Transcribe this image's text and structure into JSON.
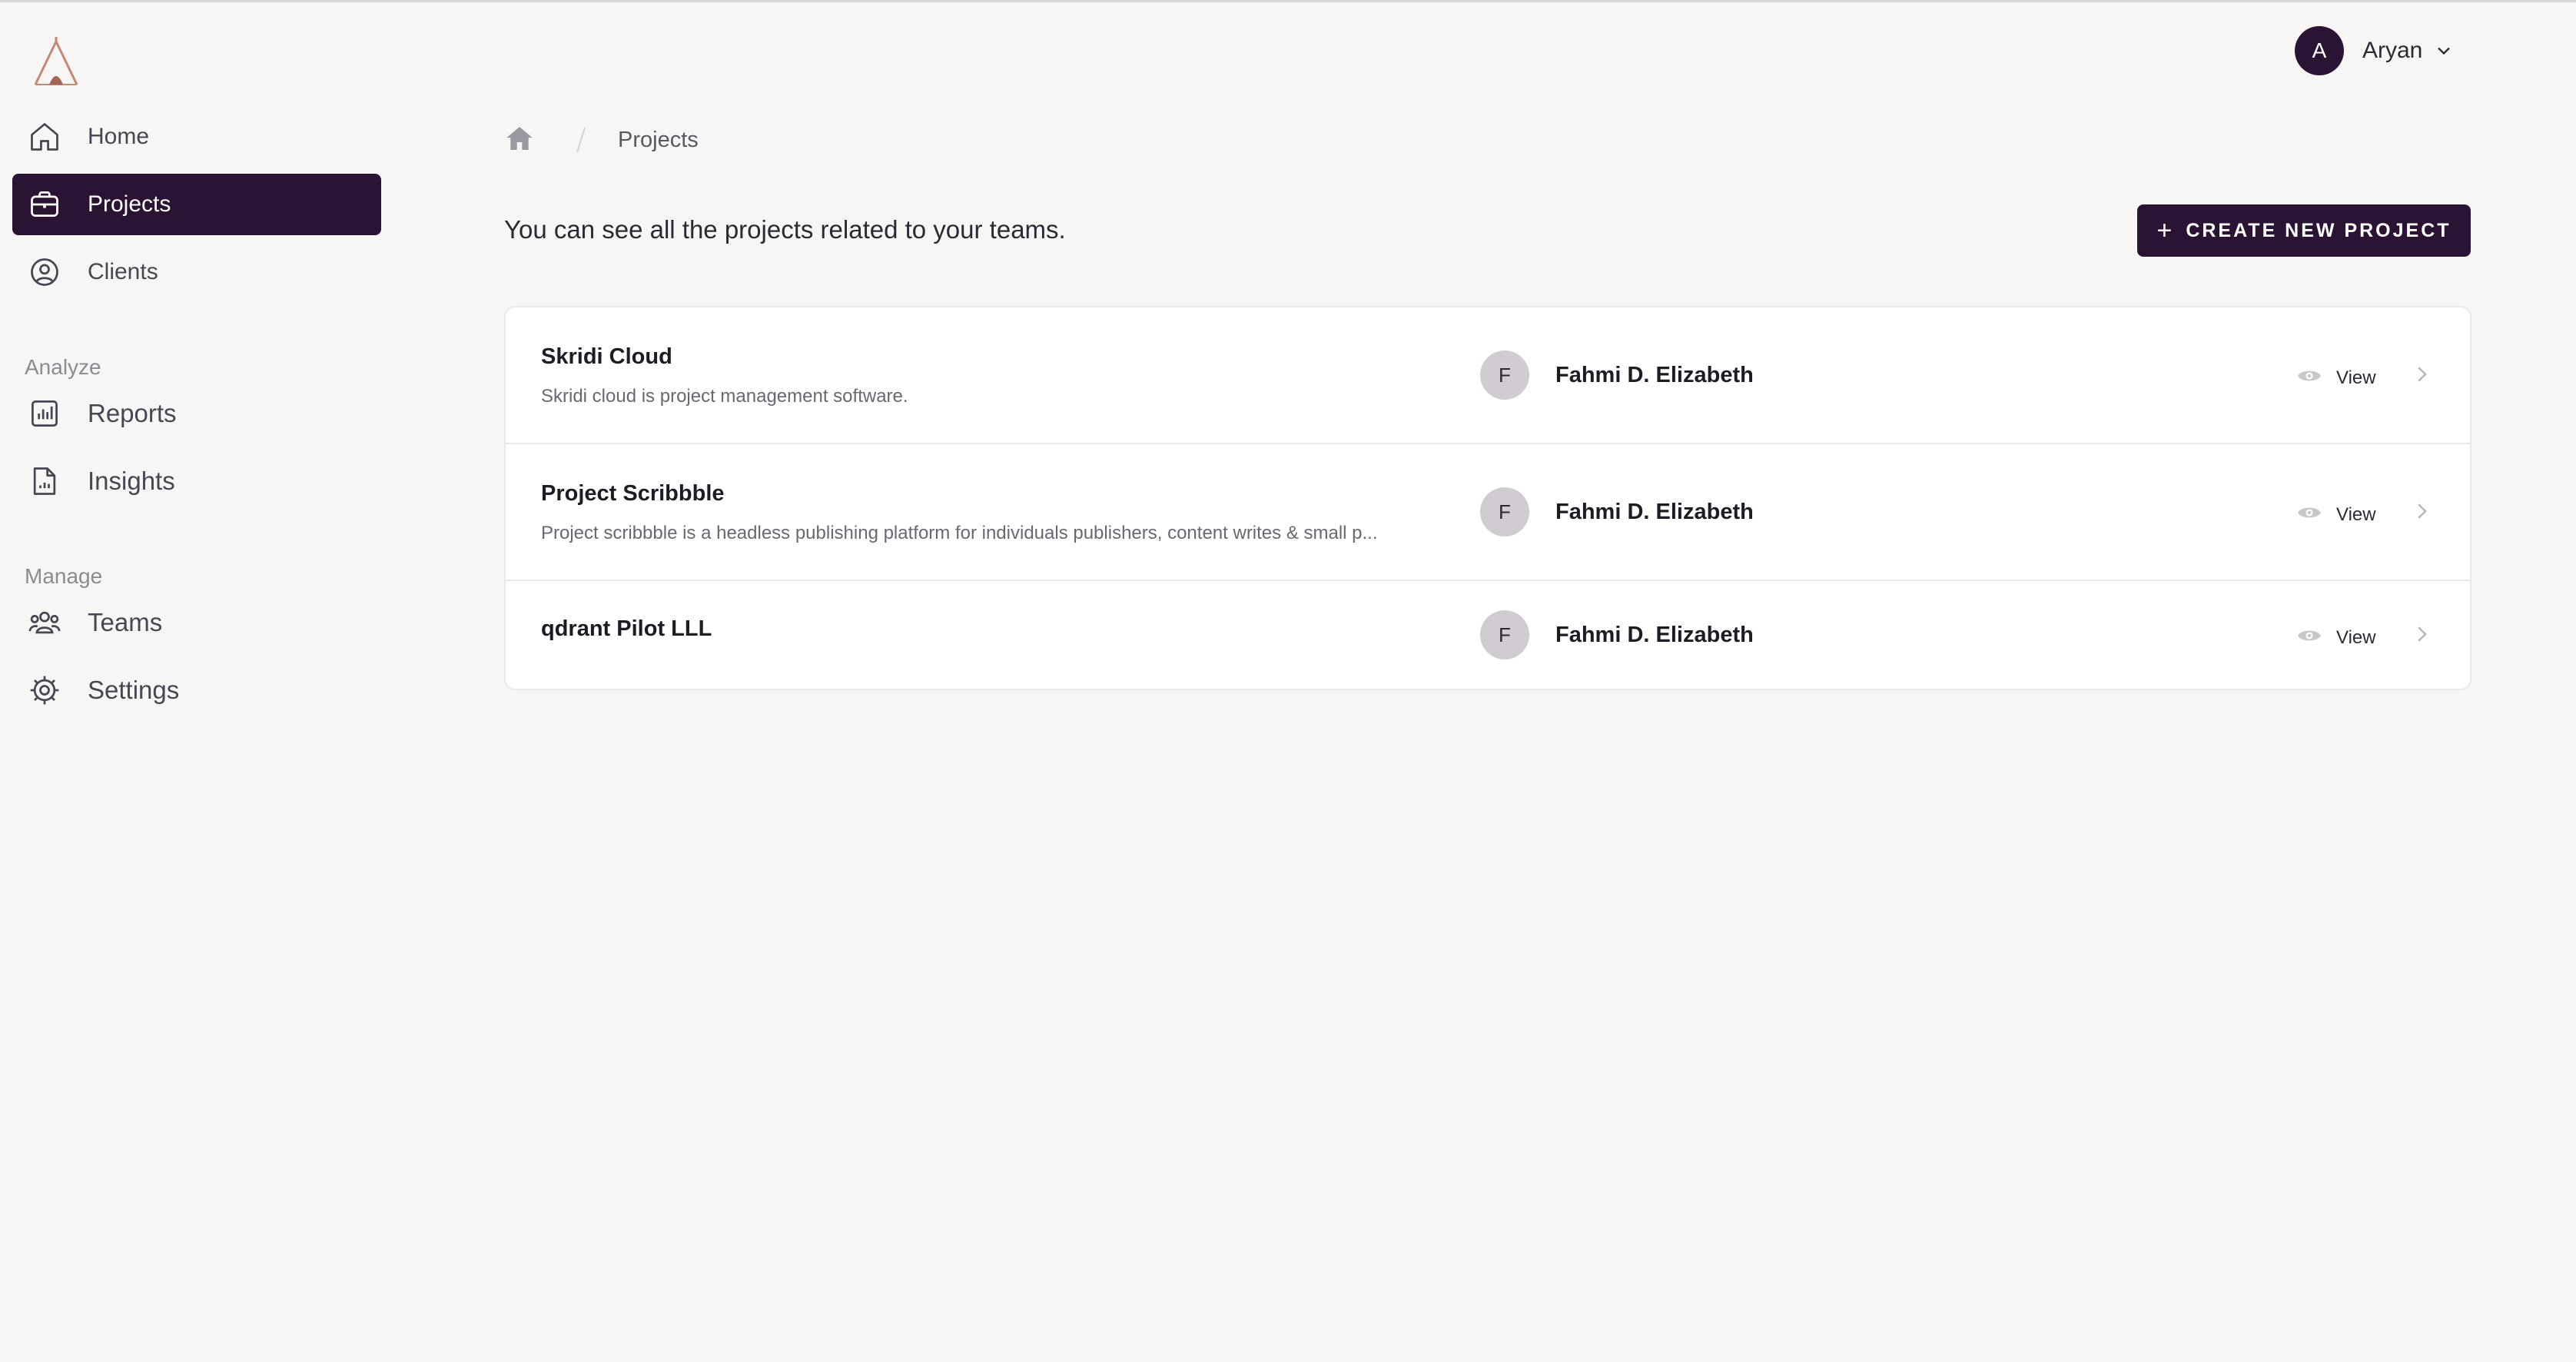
{
  "app": {
    "logo": "tent-logo"
  },
  "colors": {
    "accent": "#2a1333",
    "background": "#f8f6f5",
    "logo": "#c08a73"
  },
  "sidebar": {
    "items": [
      {
        "label": "Home",
        "icon": "home-icon"
      },
      {
        "label": "Projects",
        "icon": "briefcase-icon",
        "active": true
      },
      {
        "label": "Clients",
        "icon": "user-circle-icon"
      }
    ],
    "sections": [
      {
        "label": "Analyze",
        "items": [
          {
            "label": "Reports",
            "icon": "bar-chart-icon"
          },
          {
            "label": "Insights",
            "icon": "document-chart-icon"
          }
        ]
      },
      {
        "label": "Manage",
        "items": [
          {
            "label": "Teams",
            "icon": "users-icon"
          },
          {
            "label": "Settings",
            "icon": "gear-icon"
          }
        ]
      }
    ]
  },
  "header": {
    "user": {
      "initial": "A",
      "name": "Aryan"
    }
  },
  "breadcrumb": {
    "current": "Projects"
  },
  "main": {
    "intro": "You can see all the projects related to your teams.",
    "create_button": "CREATE NEW PROJECT",
    "projects": [
      {
        "title": "Skridi Cloud",
        "description": "Skridi cloud is project management software.",
        "owner_initial": "F",
        "owner": "Fahmi D. Elizabeth",
        "action": "View"
      },
      {
        "title": "Project Scribbble",
        "description": "Project scribbble is a headless publishing platform for individuals publishers, content writes & small p...",
        "owner_initial": "F",
        "owner": "Fahmi D. Elizabeth",
        "action": "View"
      },
      {
        "title": "qdrant Pilot LLL",
        "description": "",
        "owner_initial": "F",
        "owner": "Fahmi D. Elizabeth",
        "action": "View"
      }
    ]
  }
}
